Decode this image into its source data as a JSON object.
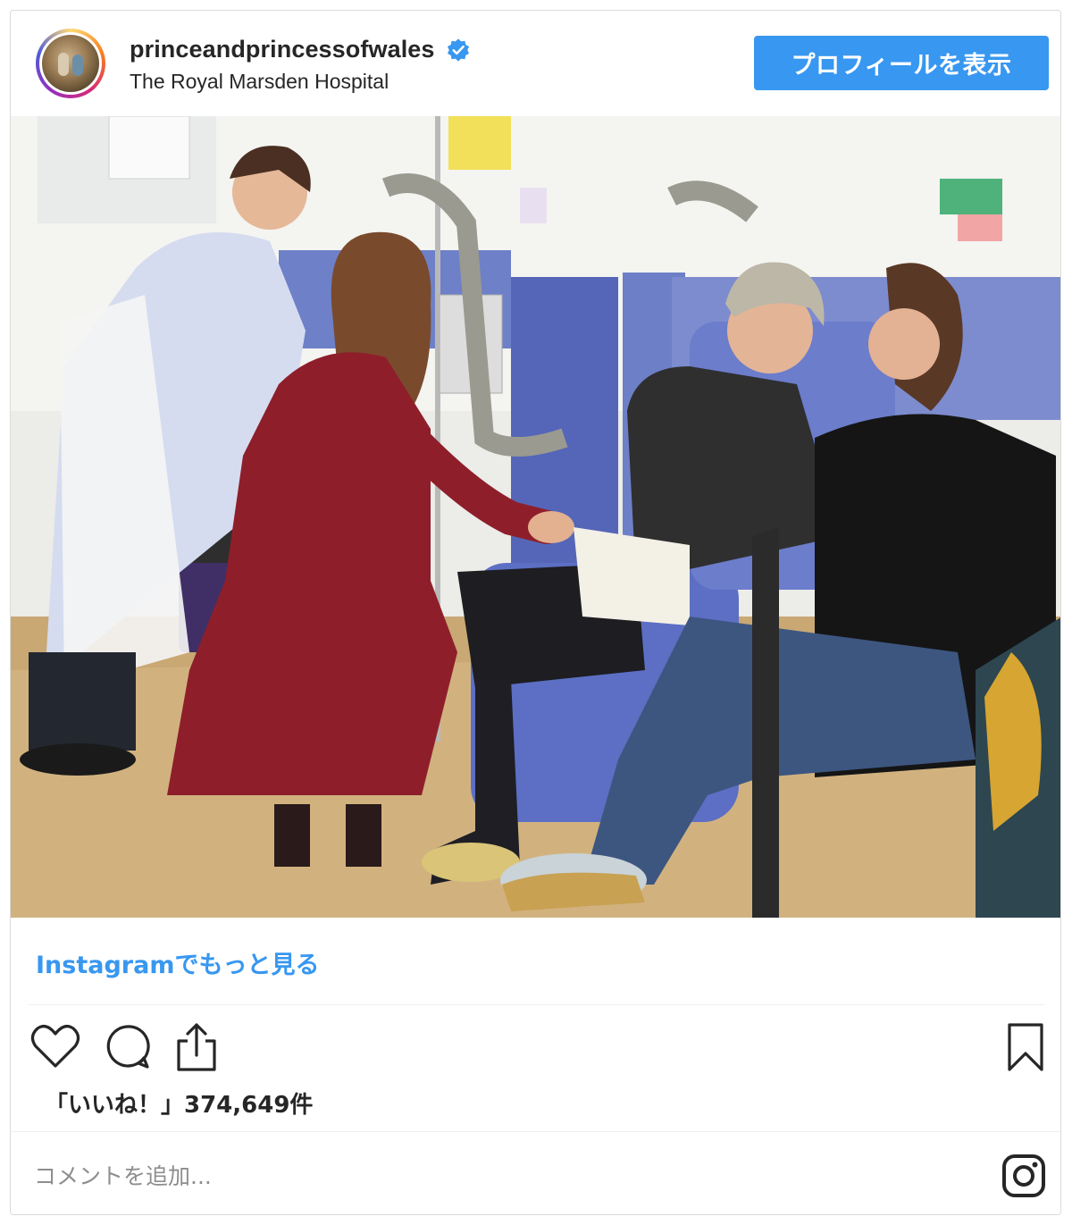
{
  "post": {
    "username": "princeandprincessofwales",
    "location": "The Royal Marsden Hospital",
    "profile_button": "プロフィールを表示",
    "more_link": "Instagramでもっと見る",
    "likes_text": "「いいね！」374,649件",
    "comment_placeholder": "コメントを追加..."
  },
  "icons": {
    "verified": "verified-badge-icon",
    "like": "heart-icon",
    "comment": "speech-bubble-icon",
    "share": "share-icon",
    "save": "bookmark-icon",
    "instagram": "instagram-logo-icon"
  },
  "colors": {
    "button_blue": "#3897f0",
    "link_blue": "#3897f0",
    "verified_blue": "#3897f0",
    "text": "#262626",
    "muted": "#8e8e8e"
  }
}
